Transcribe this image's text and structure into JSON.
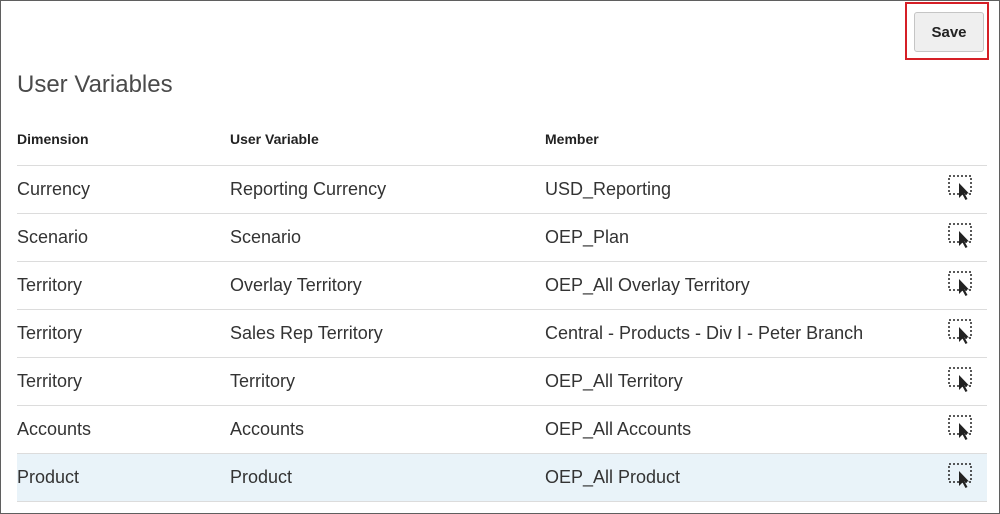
{
  "toolbar": {
    "save_label": "Save"
  },
  "page": {
    "title": "User Variables"
  },
  "table": {
    "columns": [
      "Dimension",
      "User Variable",
      "Member"
    ],
    "rows": [
      {
        "dimension": "Currency",
        "user_variable": "Reporting Currency",
        "member": "USD_Reporting",
        "icon": "member-selector-icon"
      },
      {
        "dimension": "Scenario",
        "user_variable": "Scenario",
        "member": "OEP_Plan",
        "icon": "member-selector-icon"
      },
      {
        "dimension": "Territory",
        "user_variable": "Overlay Territory",
        "member": "OEP_All Overlay Territory",
        "icon": "member-selector-icon"
      },
      {
        "dimension": "Territory",
        "user_variable": "Sales Rep Territory",
        "member": "Central - Products - Div I - Peter Branch",
        "icon": "member-selector-icon"
      },
      {
        "dimension": "Territory",
        "user_variable": "Territory",
        "member": "OEP_All Territory",
        "icon": "member-selector-icon"
      },
      {
        "dimension": "Accounts",
        "user_variable": "Accounts",
        "member": "OEP_All Accounts",
        "icon": "member-selector-icon"
      },
      {
        "dimension": "Product",
        "user_variable": "Product",
        "member": "OEP_All Product",
        "icon": "member-selector-icon",
        "selected": true
      }
    ]
  },
  "colors": {
    "highlight_border": "#d51f26",
    "selected_row": "#e9f3f9",
    "divider": "#dcdcdc"
  }
}
